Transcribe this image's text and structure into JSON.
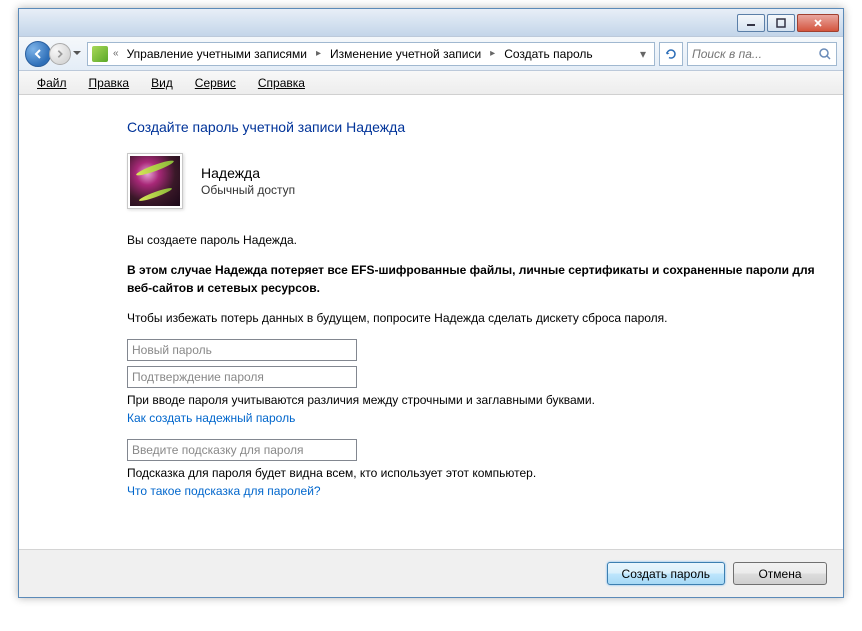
{
  "breadcrumb": {
    "items": [
      "Управление учетными записями",
      "Изменение учетной записи",
      "Создать пароль"
    ]
  },
  "search": {
    "placeholder": "Поиск в па..."
  },
  "menu": {
    "file": "Файл",
    "edit": "Правка",
    "view": "Вид",
    "tools": "Сервис",
    "help": "Справка"
  },
  "page": {
    "title": "Создайте пароль учетной записи Надежда",
    "user": {
      "name": "Надежда",
      "type": "Обычный доступ"
    },
    "intro": "Вы создаете пароль Надежда.",
    "warning": "В этом случае Надежда потеряет все EFS-шифрованные файлы, личные сертификаты и сохраненные пароли для веб-сайтов и сетевых ресурсов.",
    "advice": "Чтобы избежать потерь данных в будущем, попросите Надежда сделать дискету сброса пароля.",
    "new_password_ph": "Новый пароль",
    "confirm_password_ph": "Подтверждение пароля",
    "case_note": "При вводе пароля учитываются различия между строчными и заглавными буквами.",
    "help_strong": "Как создать надежный пароль",
    "hint_ph": "Введите подсказку для пароля",
    "hint_note": "Подсказка для пароля будет видна всем, кто использует этот компьютер.",
    "help_hint": "Что такое подсказка для паролей?"
  },
  "footer": {
    "create": "Создать пароль",
    "cancel": "Отмена"
  }
}
